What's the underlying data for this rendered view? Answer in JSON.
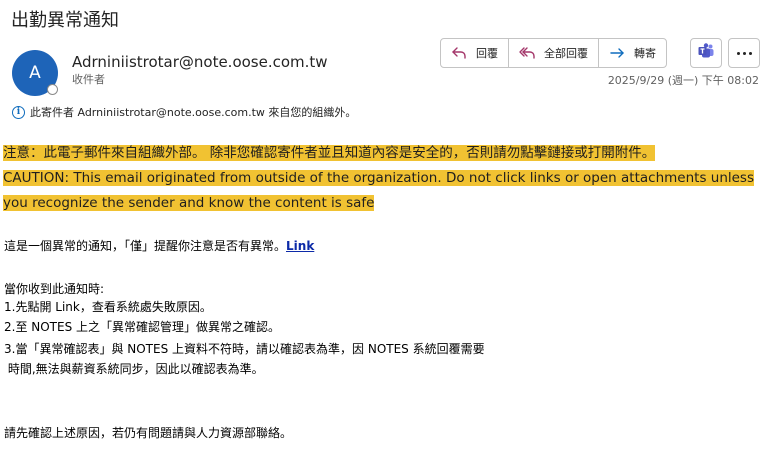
{
  "email": {
    "subject": "出勤異常通知",
    "avatar_initial": "A",
    "sender": "Adrniniistrotar@note.oose.com.tw",
    "recipient_label": "收件者",
    "datetime": "2025/9/29 (週一) 下午 08:02",
    "external_notice": "此寄件者 Adrniniistrotar@note.oose.com.tw 來自您的組織外。"
  },
  "toolbar": {
    "reply_label": "回覆",
    "reply_all_label": "全部回覆",
    "forward_label": "轉寄",
    "teams_icon": "teams-icon",
    "more_icon": "more-icon"
  },
  "caution": {
    "chinese": "注意：此電子郵件來自組織外部。 除非您確認寄件者並且知道內容是安全的，否則請勿點擊鏈接或打開附件。",
    "english": "CAUTION: This email originated from outside of the organization. Do not click links or open attachments unless you recognize the sender and know the content is safe",
    "highlight_color": "#f1c232"
  },
  "body": {
    "intro_text": "這是一個異常的通知，「僅」提醒你注意是否有異常。",
    "intro_link": "Link",
    "steps_heading": "當你收到此通知時:",
    "step1": "1.先點開 Link，查看系統處失敗原因。",
    "step2": "2.至 NOTES 上之「異常確認管理」做異常之確認。",
    "step3a": "3.當「異常確認表」與 NOTES 上資料不符時，請以確認表為準，因 NOTES 系統回覆需要",
    "step3b": " 時間,無法與薪資系統同步，因此以確認表為準。",
    "closing": "請先確認上述原因，若仍有問題請與人力資源部聯絡。"
  }
}
